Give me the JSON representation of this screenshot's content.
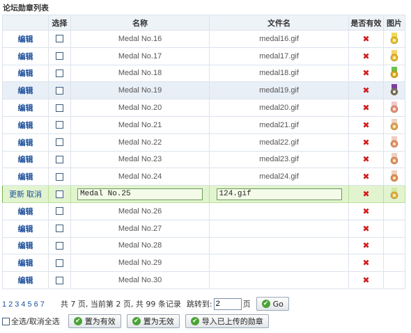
{
  "title": "论坛勋章列表",
  "headers": {
    "edit": "",
    "select": "选择",
    "name": "名称",
    "filename": "文件名",
    "valid": "是否有效",
    "image": "图片"
  },
  "edit_link": "编辑",
  "invalid_mark": "✖",
  "rows": [
    {
      "name": "Medal No.16",
      "file": "medal16.gif",
      "medal_color": "#e8c12a",
      "ribbon": "#f2d75a"
    },
    {
      "name": "Medal No.17",
      "file": "medal17.gif",
      "medal_color": "#e8b62a",
      "ribbon": "#f5d26a"
    },
    {
      "name": "Medal No.18",
      "file": "medal18.gif",
      "medal_color": "#d9a820",
      "ribbon": "#6fbf4a"
    },
    {
      "name": "Medal No.19",
      "file": "medal19.gif",
      "medal_color": "#6a6a6a",
      "ribbon": "#7a3fa0"
    },
    {
      "name": "Medal No.20",
      "file": "medal20.gif",
      "medal_color": "#e78a8a",
      "ribbon": "#f0c9c9"
    },
    {
      "name": "Medal No.21",
      "file": "medal21.gif",
      "medal_color": "#e4a05a",
      "ribbon": "#f0d2c0"
    },
    {
      "name": "Medal No.22",
      "file": "medal22.gif",
      "medal_color": "#e88a70",
      "ribbon": "#f2cdbf"
    },
    {
      "name": "Medal No.23",
      "file": "medal23.gif",
      "medal_color": "#e0906a",
      "ribbon": "#f0d0c0"
    },
    {
      "name": "Medal No.24",
      "file": "medal24.gif",
      "medal_color": "#e38a5a",
      "ribbon": "#f1cfbf"
    },
    {
      "name": "Medal No.25",
      "file": "124.gif",
      "editing": true,
      "medal_color": "#e2b040",
      "ribbon": "#d7e9a0"
    },
    {
      "name": "Medal No.26",
      "file": ""
    },
    {
      "name": "Medal No.27",
      "file": ""
    },
    {
      "name": "Medal No.28",
      "file": ""
    },
    {
      "name": "Medal No.29",
      "file": ""
    },
    {
      "name": "Medal No.30",
      "file": ""
    }
  ],
  "edit_row_actions": {
    "update": "更新",
    "cancel": "取消"
  },
  "pager": {
    "pages": [
      "1",
      "2",
      "3",
      "4",
      "5",
      "6",
      "7"
    ],
    "info": "共 7 页, 当前第 2 页, 共 99 条记录",
    "jump_label": "跳转到:",
    "jump_value": "2",
    "page_unit": "页",
    "go_label": "Go"
  },
  "bottom": {
    "select_all": "全选/取消全选",
    "set_valid": "置为有效",
    "set_invalid": "置为无效",
    "import": "导入已上传的勋章"
  }
}
